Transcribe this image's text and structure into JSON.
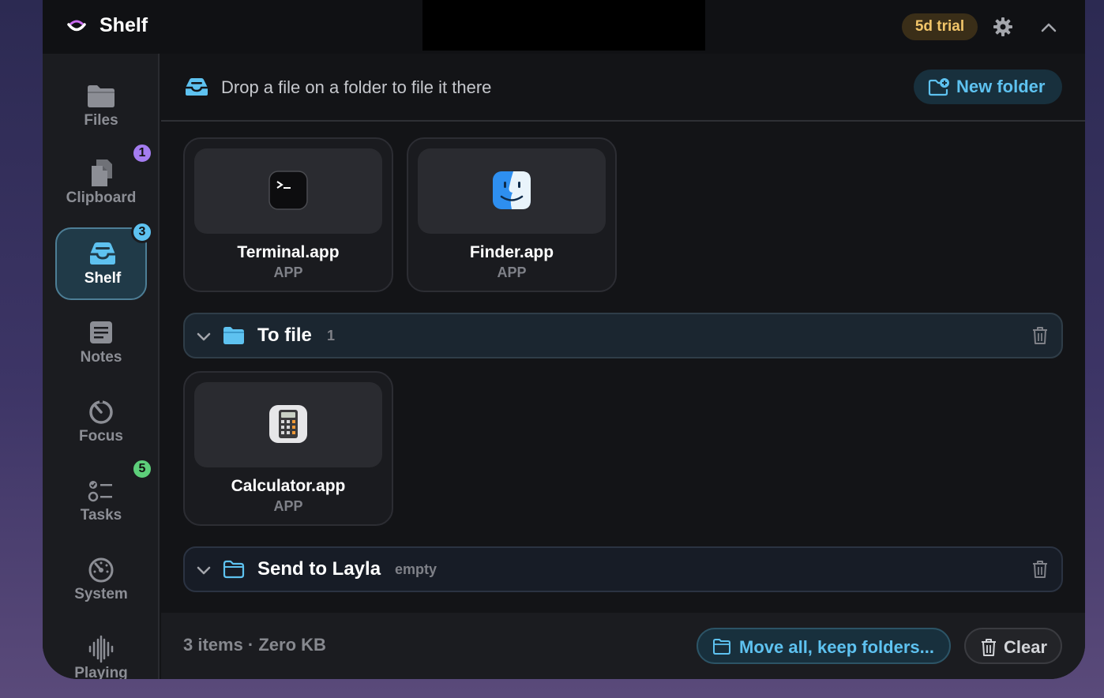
{
  "app": {
    "title": "Shelf",
    "trial_badge": "5d trial"
  },
  "colors": {
    "accent": "#5ec2f0",
    "trial": "#f1c56a",
    "background": "#131417"
  },
  "sidebar": {
    "items": [
      {
        "label": "Files",
        "icon": "folder-icon"
      },
      {
        "label": "Clipboard",
        "icon": "clipboard-icon",
        "badge": "1"
      },
      {
        "label": "Shelf",
        "icon": "tray-icon",
        "badge": "3",
        "active": true
      },
      {
        "label": "Notes",
        "icon": "notes-icon"
      },
      {
        "label": "Focus",
        "icon": "timer-icon"
      },
      {
        "label": "Tasks",
        "icon": "tasks-icon",
        "badge": "5"
      },
      {
        "label": "System",
        "icon": "gauge-icon"
      },
      {
        "label": "Playing",
        "icon": "waveform-icon"
      }
    ]
  },
  "drop_hint": "Drop a file on a folder to file it there",
  "new_folder_label": "New folder",
  "shelf_items": [
    {
      "name": "Terminal.app",
      "kind": "APP",
      "icon": "terminal-icon"
    },
    {
      "name": "Finder.app",
      "kind": "APP",
      "icon": "finder-icon"
    }
  ],
  "folders": [
    {
      "name": "To file",
      "count": "1",
      "icon": "folder-icon",
      "items": [
        {
          "name": "Calculator.app",
          "kind": "APP",
          "icon": "calculator-icon"
        }
      ]
    },
    {
      "name": "Send to Layla",
      "count": "empty",
      "icon": "folder-outline-icon",
      "items": []
    }
  ],
  "footer": {
    "summary": "3 items · Zero KB",
    "move_all_label": "Move all, keep folders...",
    "clear_label": "Clear"
  }
}
